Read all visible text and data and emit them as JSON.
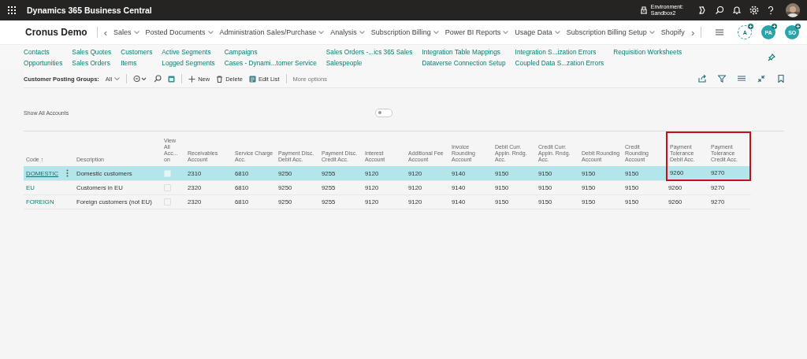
{
  "top_bar": {
    "app_name": "Dynamics 365 Business Central",
    "environment_label": "Environment:",
    "environment_name": "Sandbox2"
  },
  "nav": {
    "company": "Cronus Demo",
    "prev": "‹",
    "next": "›",
    "items": [
      {
        "label": "Sales"
      },
      {
        "label": "Posted Documents"
      },
      {
        "label": "Administration Sales/Purchase"
      },
      {
        "label": "Analysis"
      },
      {
        "label": "Subscription Billing"
      },
      {
        "label": "Power BI Reports"
      },
      {
        "label": "Usage Data"
      },
      {
        "label": "Subscription Billing Setup"
      },
      {
        "label": "Shopify"
      }
    ],
    "avatars": [
      {
        "initials": "A",
        "kind": "outline"
      },
      {
        "initials": "PA",
        "kind": "filled"
      },
      {
        "initials": "SO",
        "kind": "filled"
      }
    ]
  },
  "links": [
    {
      "items": [
        "Contacts",
        "Opportunities"
      ]
    },
    {
      "items": [
        "Sales Quotes",
        "Sales Orders"
      ]
    },
    {
      "items": [
        "Customers",
        "Items"
      ]
    },
    {
      "items": [
        "Active Segments",
        "Logged Segments"
      ]
    },
    {
      "items": [
        "Campaigns",
        "Cases - Dynami...tomer Service"
      ]
    },
    {
      "items": [
        "Sales Orders -...ics 365 Sales",
        "Salespeople"
      ]
    },
    {
      "items": [
        "Integration Table Mappings",
        "Dataverse Connection Setup"
      ]
    },
    {
      "items": [
        "Integration S...ization Errors",
        "Coupled Data S...zation Errors"
      ]
    },
    {
      "items": [
        "Requisition Worksheets"
      ]
    }
  ],
  "toolbar": {
    "filter_label": "Customer Posting Groups:",
    "filter_value": "All",
    "actions": [
      {
        "kind": "new",
        "label": "New"
      },
      {
        "kind": "delete",
        "label": "Delete"
      },
      {
        "kind": "edit",
        "label": "Edit List"
      }
    ],
    "more": "More options"
  },
  "show_all_accounts": {
    "label": "Show All Accounts",
    "on": false
  },
  "table": {
    "columns": [
      {
        "label": "Code",
        "sort_mark": "↑",
        "highlighted": false
      },
      {
        "label": "Description",
        "highlighted": false
      },
      {
        "label": "View All Acc... on",
        "highlighted": false
      },
      {
        "label": "Receivables Account",
        "highlighted": false
      },
      {
        "label": "Service Charge Acc.",
        "highlighted": false
      },
      {
        "label": "Payment Disc. Debit Acc.",
        "highlighted": false
      },
      {
        "label": "Payment Disc. Credit Acc.",
        "highlighted": false
      },
      {
        "label": "Interest Account",
        "highlighted": false
      },
      {
        "label": "Additional Fee Account",
        "highlighted": false
      },
      {
        "label": "Invoice Rounding Account",
        "highlighted": false
      },
      {
        "label": "Debit Curr. Appln. Rndg. Acc.",
        "highlighted": false
      },
      {
        "label": "Credit Curr. Appln. Rndg. Acc.",
        "highlighted": false
      },
      {
        "label": "Debit Rounding Account",
        "highlighted": false
      },
      {
        "label": "Credit Rounding Account",
        "highlighted": false
      },
      {
        "label": "Payment Tolerance Debit Acc.",
        "highlighted": true
      },
      {
        "label": "Payment Tolerance Credit Acc.",
        "highlighted": true
      }
    ],
    "rows": [
      {
        "selected": true,
        "highlighted": true,
        "code": "DOMESTIC",
        "description": "Domestic customers",
        "view_all_accounts": false,
        "accounts": [
          "2310",
          "6810",
          "9250",
          "9255",
          "9120",
          "9120",
          "9140",
          "9150",
          "9150",
          "9150",
          "9150",
          "9260",
          "9270"
        ]
      },
      {
        "selected": false,
        "highlighted": false,
        "code": "EU",
        "description": "Customers in EU",
        "view_all_accounts": false,
        "accounts": [
          "2320",
          "6810",
          "9250",
          "9255",
          "9120",
          "9120",
          "9140",
          "9150",
          "9150",
          "9150",
          "9150",
          "9260",
          "9270"
        ]
      },
      {
        "selected": false,
        "highlighted": false,
        "code": "FOREIGN",
        "description": "Foreign customers (not EU)",
        "view_all_accounts": false,
        "accounts": [
          "2320",
          "6810",
          "9250",
          "9255",
          "9120",
          "9120",
          "9140",
          "9150",
          "9150",
          "9150",
          "9150",
          "9260",
          "9270"
        ]
      }
    ],
    "annotation": {
      "kind": "frame",
      "color": "#c50f1f"
    }
  }
}
